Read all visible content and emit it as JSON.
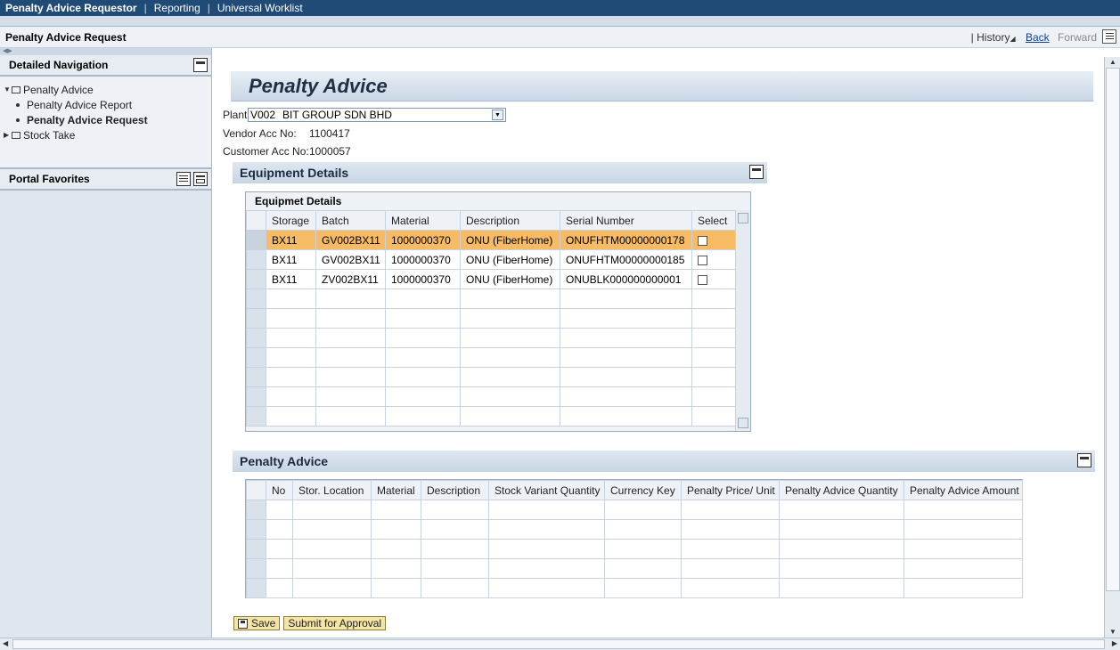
{
  "topnav": {
    "items": [
      "Penalty Advice Requestor",
      "Reporting",
      "Universal Worklist"
    ],
    "separator": "|"
  },
  "titlebar": {
    "title": "Penalty Advice Request",
    "history_sep": "|",
    "history": "History",
    "back": "Back",
    "forward": "Forward"
  },
  "leftnav": {
    "detailed_nav_title": "Detailed Navigation",
    "tree": {
      "penalty_advice": "Penalty Advice",
      "report": "Penalty Advice Report",
      "request": "Penalty Advice Request",
      "stock_take": "Stock Take"
    },
    "portal_favorites": "Portal Favorites"
  },
  "form": {
    "heading": "Penalty Advice",
    "plant_label": "Plant:",
    "plant_code": "V002",
    "plant_name": "BIT GROUP SDN BHD",
    "vendor_label": "Vendor Acc No:",
    "vendor_value": "1100417",
    "customer_label": "Customer Acc No:",
    "customer_value": "1000057"
  },
  "equipment": {
    "panel_title": "Equipment Details",
    "grid_title": "Equipmet Details",
    "columns": [
      "Storage",
      "Batch",
      "Material",
      "Description",
      "Serial Number",
      "Select"
    ],
    "rows": [
      [
        "BX11",
        "GV002BX11",
        "1000000370",
        "ONU (FiberHome)",
        "ONUFHTM00000000178"
      ],
      [
        "BX11",
        "GV002BX11",
        "1000000370",
        "ONU (FiberHome)",
        "ONUFHTM00000000185"
      ],
      [
        "BX11",
        "ZV002BX11",
        "1000000370",
        "ONU (FiberHome)",
        "ONUBLK000000000001"
      ]
    ]
  },
  "penalty": {
    "panel_title": "Penalty Advice",
    "columns": [
      "No",
      "Stor. Location",
      "Material",
      "Description",
      "Stock Variant Quantity",
      "Currency Key",
      "Penalty Price/ Unit",
      "Penalty Advice Quantity",
      "Penalty Advice Amount"
    ]
  },
  "actions": {
    "save": "Save",
    "submit": "Submit for Approval"
  },
  "colors": {
    "topbar": "#1f4b76",
    "selected_row": "#f7bb63",
    "button": "#f3e4a8"
  }
}
